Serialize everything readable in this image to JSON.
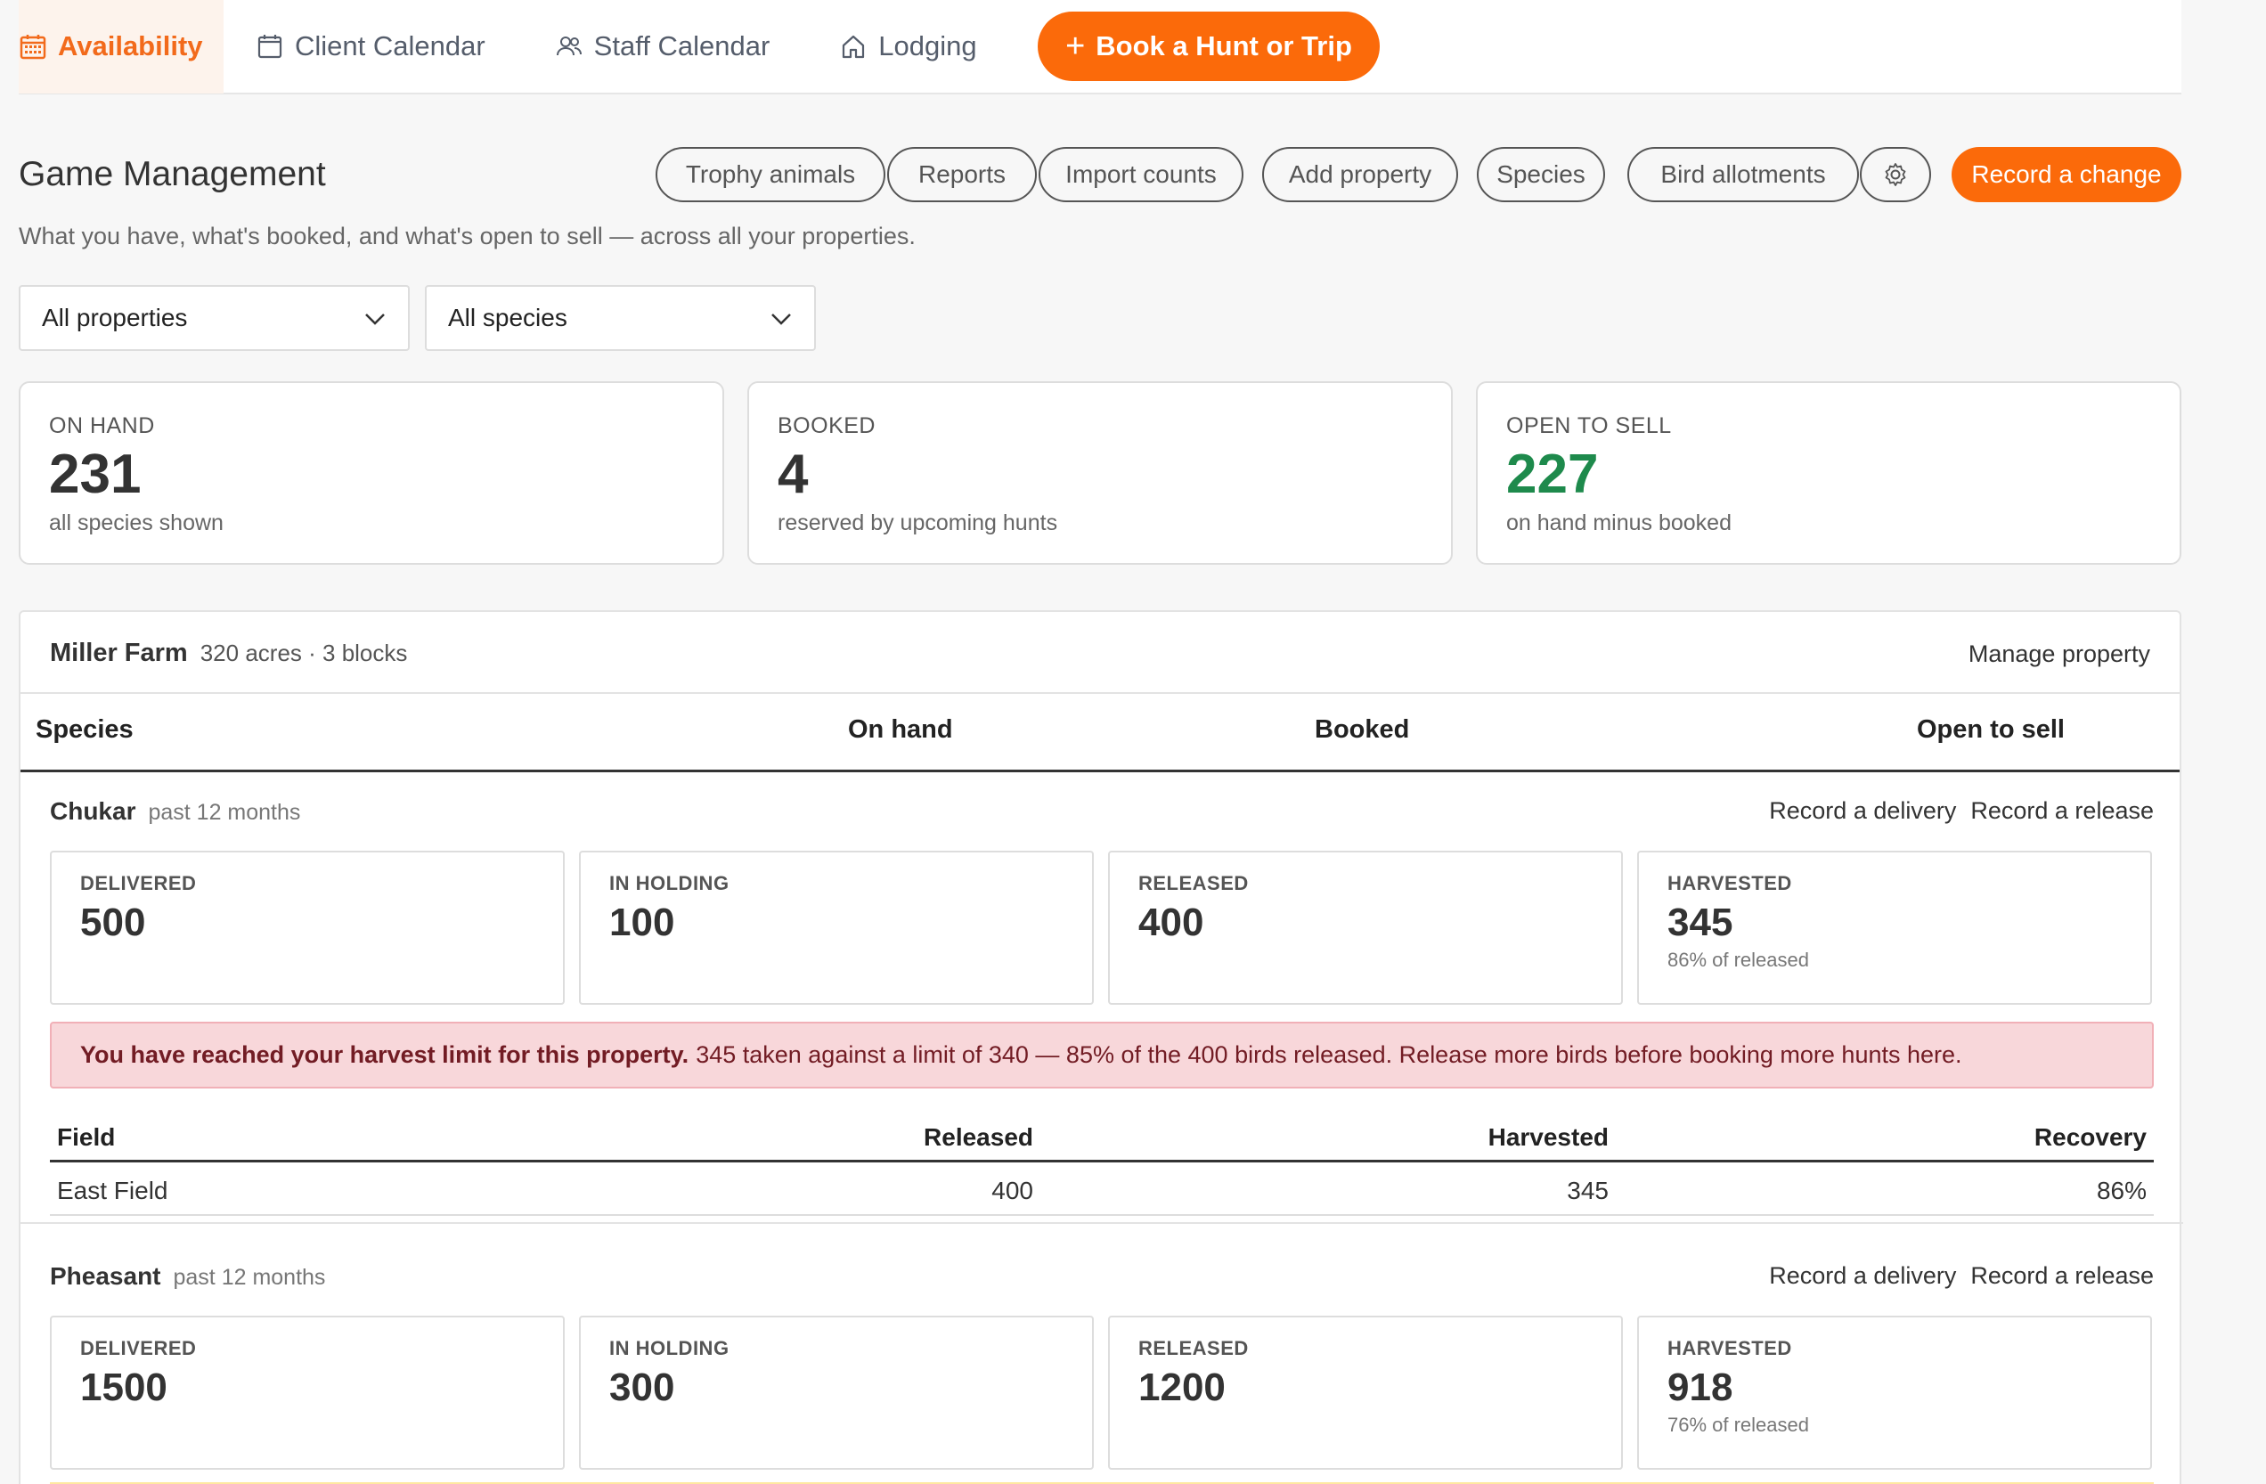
{
  "nav": {
    "items": [
      {
        "label": "Availability",
        "icon": "calendar-grid-icon",
        "active": true
      },
      {
        "label": "Client Calendar",
        "icon": "calendar-icon"
      },
      {
        "label": "Staff Calendar",
        "icon": "users-icon"
      },
      {
        "label": "Lodging",
        "icon": "home-icon"
      }
    ],
    "book_button": "Book a Hunt or Trip",
    "book_plus": "+"
  },
  "colors": {
    "accent": "#fb6a0a",
    "green": "#1e8a4c",
    "alert_bg": "#f8d7da"
  },
  "page": {
    "title": "Game Management",
    "subtitle": "What you have, what's booked, and what's open to sell — across all your properties."
  },
  "toolbar": {
    "buttons": [
      "Trophy animals",
      "Reports",
      "Import counts",
      "Add property",
      "Species",
      "Bird allotments"
    ],
    "settings_icon": "gear-icon",
    "record_change": "Record a change"
  },
  "filters": {
    "property": "All properties",
    "species": "All species"
  },
  "stats": [
    {
      "label": "ON HAND",
      "value": "231",
      "sub": "all species shown"
    },
    {
      "label": "BOOKED",
      "value": "4",
      "sub": "reserved by upcoming hunts"
    },
    {
      "label": "OPEN TO SELL",
      "value": "227",
      "sub": "on hand minus booked"
    }
  ],
  "property": {
    "name": "Miller Farm",
    "meta": "320 acres · 3 blocks",
    "manage": "Manage property",
    "columns": [
      "Species",
      "On hand",
      "Booked",
      "Open to sell"
    ]
  },
  "species": [
    {
      "name": "Chukar",
      "period": "past 12 months",
      "actions": [
        "Record a delivery",
        "Record a release"
      ],
      "metrics": [
        {
          "label": "DELIVERED",
          "value": "500",
          "sub": ""
        },
        {
          "label": "IN HOLDING",
          "value": "100",
          "sub": ""
        },
        {
          "label": "RELEASED",
          "value": "400",
          "sub": ""
        },
        {
          "label": "HARVESTED",
          "value": "345",
          "sub": "86% of released"
        }
      ],
      "alert_bold": "You have reached your harvest limit for this property.",
      "alert_text": "345 taken against a limit of 340 — 85% of the 400 birds released. Release more birds before booking more hunts here.",
      "field_columns": [
        "Field",
        "Released",
        "Harvested",
        "Recovery"
      ],
      "fields": [
        {
          "field": "East Field",
          "released": "400",
          "harvested": "345",
          "recovery": "86%"
        }
      ]
    },
    {
      "name": "Pheasant",
      "period": "past 12 months",
      "actions": [
        "Record a delivery",
        "Record a release"
      ],
      "metrics": [
        {
          "label": "DELIVERED",
          "value": "1500",
          "sub": ""
        },
        {
          "label": "IN HOLDING",
          "value": "300",
          "sub": ""
        },
        {
          "label": "RELEASED",
          "value": "1200",
          "sub": ""
        },
        {
          "label": "HARVESTED",
          "value": "918",
          "sub": "76% of released"
        }
      ]
    }
  ]
}
